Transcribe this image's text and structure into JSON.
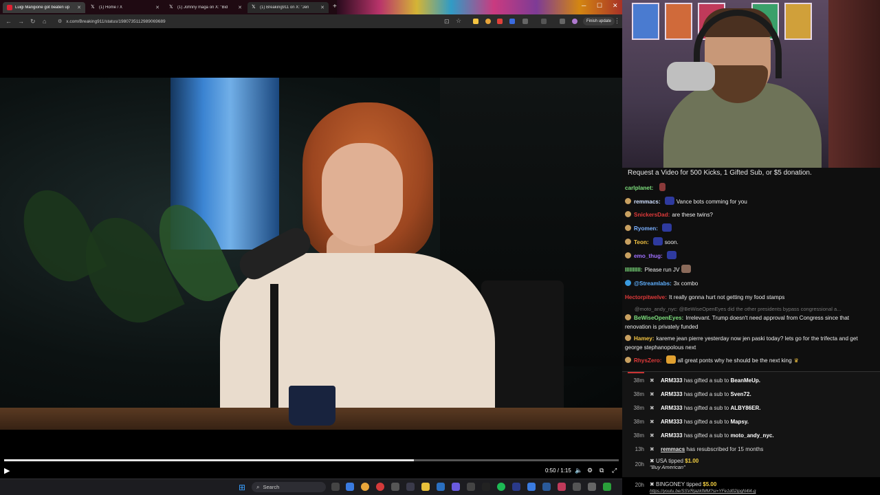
{
  "browser": {
    "tabs": [
      {
        "label": "Luigi Mangione got beaten up",
        "icon": "red-page-icon"
      },
      {
        "label": "(1) Home / X",
        "icon": "x-logo-icon"
      },
      {
        "label": "(1) Johnny maga on X: \"Bid",
        "icon": "x-logo-icon"
      },
      {
        "label": "(1) Breaking911 on X: \"Jen",
        "icon": "x-logo-icon"
      }
    ],
    "url": "x.com/Breaking911/status/1980735112989069689",
    "finish_update": "Finish update"
  },
  "video": {
    "time": "0:50 / 1:15",
    "progress": 0.667
  },
  "chat": {
    "banner": "Request a Video for 500 Kicks, 1 Gifted Sub, or $5 donation.",
    "messages": [
      {
        "user": "carlplanet:",
        "color": "#7ee07e",
        "text": ""
      },
      {
        "user": "remmacs:",
        "color": "#d0e0ff",
        "text": "Vance bots comming for you"
      },
      {
        "user": "SnickersDad:",
        "color": "#e03a3a",
        "text": "are these twins?"
      },
      {
        "user": "Ryomen:",
        "color": "#7ab0ff",
        "text": ""
      },
      {
        "user": "Teon:",
        "color": "#f5c542",
        "text": "soon."
      },
      {
        "user": "emo_thug:",
        "color": "#a070ff",
        "text": ""
      },
      {
        "user": "IIIIIIIIII:",
        "color": "#7ee07e",
        "text": "Please run JV"
      },
      {
        "user": "@Streamlabs:",
        "color": "#5fb0ff",
        "text": "3x   combo"
      },
      {
        "user": "Hectorpitwelve:",
        "color": "#e03a3a",
        "text": "It really gonna hurt not getting my food stamps"
      },
      {
        "user": "@moto_andy_nyc:",
        "color": "#777777",
        "text": "@BeWiseOpenEyes did the other presidents bypass congressional a..."
      },
      {
        "user": "BeWiseOpenEyes:",
        "color": "#7ee07e",
        "text": "Irrelevant. Trump doesn't need approval from Congress since that renovation is privately funded"
      },
      {
        "user": "Hamey:",
        "color": "#f5c542",
        "text": "kareme jean pierre yesterday now jen paski today? lets go for the trifecta and get george stephanopolous next"
      },
      {
        "user": "RhysZero:",
        "color": "#e03a3a",
        "text": "all great ponts why he should be the next king"
      }
    ]
  },
  "feed": {
    "gifts": [
      {
        "age": "38m",
        "gifter": "ARM333",
        "text": "has gifted a sub to",
        "recipient": "BeanMeUp."
      },
      {
        "age": "38m",
        "gifter": "ARM333",
        "text": "has gifted a sub to",
        "recipient": "Sven72."
      },
      {
        "age": "38m",
        "gifter": "ARM333",
        "text": "has gifted a sub to",
        "recipient": "ALBY86ER."
      },
      {
        "age": "38m",
        "gifter": "ARM333",
        "text": "has gifted a sub to",
        "recipient": "Mapsy."
      },
      {
        "age": "38m",
        "gifter": "ARM333",
        "text": "has gifted a sub to",
        "recipient": "moto_andy_nyc."
      },
      {
        "age": "13h",
        "gifter": "remmacs",
        "text": "has resubscribed for 15 months",
        "recipient": ""
      }
    ],
    "tips": [
      {
        "age": "20h",
        "user": "USA",
        "text": "tipped",
        "amount": "$1.00",
        "message": "\"Buy American\""
      },
      {
        "age": "20h",
        "user": "BINGONEY",
        "text": "tipped",
        "amount": "$5.00",
        "message": "https://youtu.be/SSVRjazkfMM?si=YFe1d02ipgN4l4-g"
      }
    ]
  },
  "taskbar": {
    "search": "Search"
  }
}
